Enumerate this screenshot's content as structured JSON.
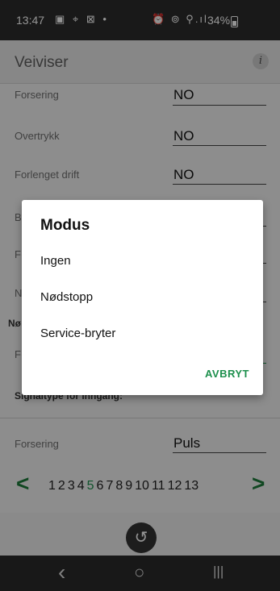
{
  "status_bar": {
    "time": "13:47",
    "left_icons": "▣ ⌖ ⊠ •",
    "right_icons": "⏰ ⊚ ⚲.ıl",
    "battery": "34%"
  },
  "app_bar": {
    "title": "Veiviser",
    "info_icon_glyph": "i"
  },
  "form": {
    "rows": [
      {
        "label": "Forsering",
        "value": "NO"
      },
      {
        "label": "Overtrykk",
        "value": "NO"
      },
      {
        "label": "Forlenget drift",
        "value": "NO"
      }
    ],
    "partial_labels": [
      "B",
      "F",
      "N",
      "F"
    ],
    "section_prefix": "Nø",
    "signal_section": "Signaltype for inngang:",
    "signal_row": {
      "label": "Forsering",
      "value": "Puls"
    }
  },
  "pager": {
    "prev": "<",
    "next": ">",
    "pages": [
      "1",
      "2",
      "3",
      "4",
      "5",
      "6",
      "7",
      "8",
      "9",
      "10",
      "11",
      "12",
      "13"
    ],
    "active_page": "5"
  },
  "fab_glyph": "↺",
  "nav": {
    "back": "‹",
    "home": "○",
    "recents": "|||"
  },
  "dialog": {
    "title": "Modus",
    "options": [
      "Ingen",
      "Nødstopp",
      "Service-bryter"
    ],
    "cancel_label": "AVBRYT"
  },
  "colors": {
    "accent": "#1c8f4c",
    "statusbar": "#2c2c2c"
  }
}
